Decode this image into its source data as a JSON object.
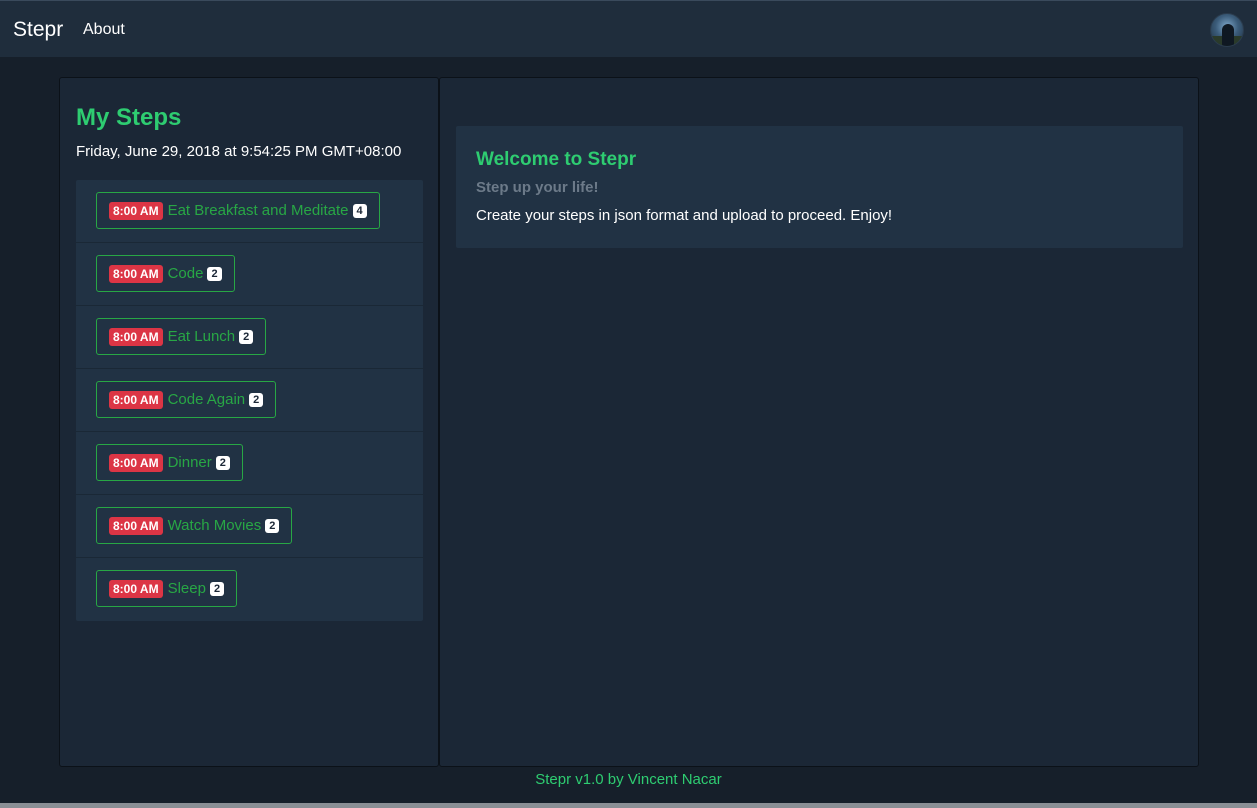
{
  "navbar": {
    "brand": "Stepr",
    "links": [
      "About"
    ]
  },
  "sidebar": {
    "title": "My Steps",
    "date": "Friday, June 29, 2018 at 9:54:25 PM GMT+08:00",
    "steps": [
      {
        "time": "8:00 AM",
        "label": "Eat Breakfast and Meditate",
        "count": "4"
      },
      {
        "time": "8:00 AM",
        "label": "Code",
        "count": "2"
      },
      {
        "time": "8:00 AM",
        "label": "Eat Lunch",
        "count": "2"
      },
      {
        "time": "8:00 AM",
        "label": "Code Again",
        "count": "2"
      },
      {
        "time": "8:00 AM",
        "label": "Dinner",
        "count": "2"
      },
      {
        "time": "8:00 AM",
        "label": "Watch Movies",
        "count": "2"
      },
      {
        "time": "8:00 AM",
        "label": "Sleep",
        "count": "2"
      }
    ]
  },
  "welcome": {
    "title": "Welcome to Stepr",
    "subtitle": "Step up your life!",
    "text": "Create your steps in json format and upload to proceed. Enjoy!"
  },
  "footer": {
    "text": "Stepr v1.0 by Vincent Nacar"
  },
  "colors": {
    "accent": "#2ecc71",
    "button_green": "#28a745",
    "time_badge": "#dc3545",
    "navbar_bg": "#1f2d3c",
    "page_bg": "#161f2a",
    "panel_bg": "#1b2736"
  }
}
